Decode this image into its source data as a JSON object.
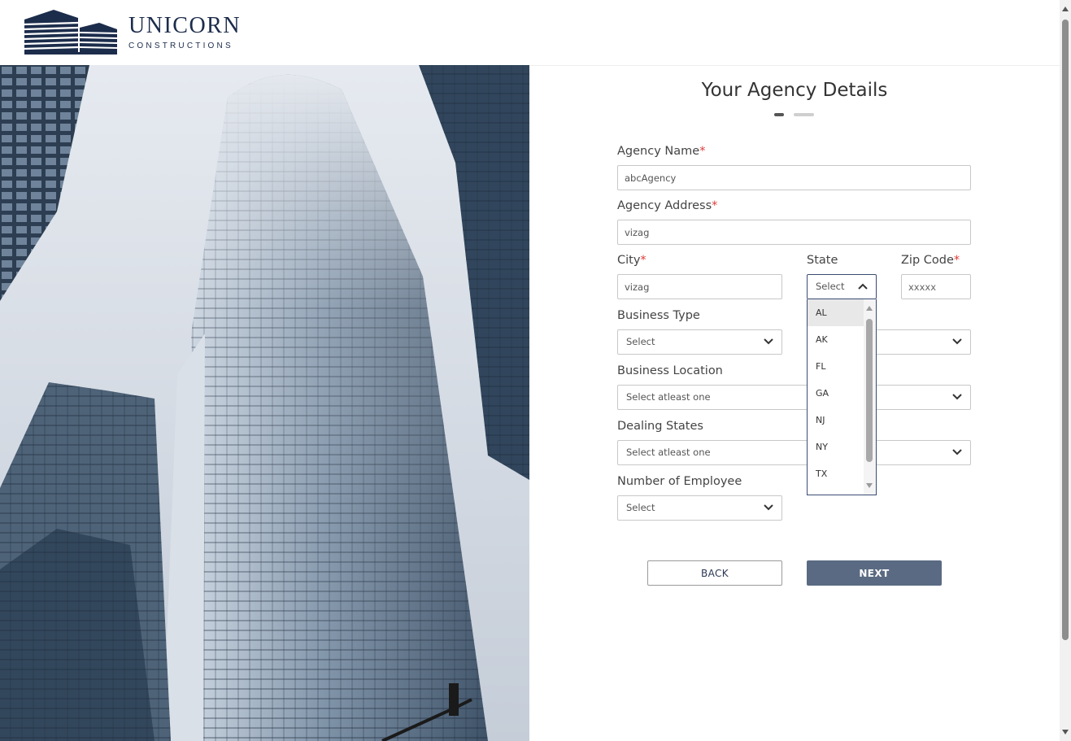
{
  "brand": {
    "name": "UNICORN",
    "subtitle": "CONSTRUCTIONS",
    "color": "#1c2c4b"
  },
  "hero": {
    "image": "skyscraper-photo"
  },
  "form": {
    "title": "Your Agency Details",
    "step": {
      "current": 1,
      "total": 2
    },
    "agency_name": {
      "label": "Agency Name",
      "required_mark": "*",
      "value": "abcAgency"
    },
    "agency_address": {
      "label": "Agency Address",
      "required_mark": "*",
      "value": "vizag"
    },
    "city": {
      "label": "City",
      "required_mark": "*",
      "value": "vizag"
    },
    "state": {
      "label": "State",
      "selected": "Select",
      "options": [
        "AL",
        "AK",
        "FL",
        "GA",
        "NJ",
        "NY",
        "TX"
      ],
      "highlighted": "AL",
      "open": true
    },
    "zip_code": {
      "label": "Zip Code",
      "required_mark": "*",
      "placeholder": "xxxxx"
    },
    "business_type": {
      "label": "Business Type",
      "selected": "Select"
    },
    "business_location": {
      "label": "Business Location",
      "selected": "Select atleast one"
    },
    "dealing_states": {
      "label": "Dealing States",
      "selected": "Select atleast one"
    },
    "number_of_employee": {
      "label": "Number of Employee",
      "selected": "Select"
    },
    "back_label": "BACK",
    "next_label": "NEXT"
  },
  "colors": {
    "accent": "#3a4c73",
    "next_button": "#5a6a82",
    "required": "#e03a3a"
  }
}
